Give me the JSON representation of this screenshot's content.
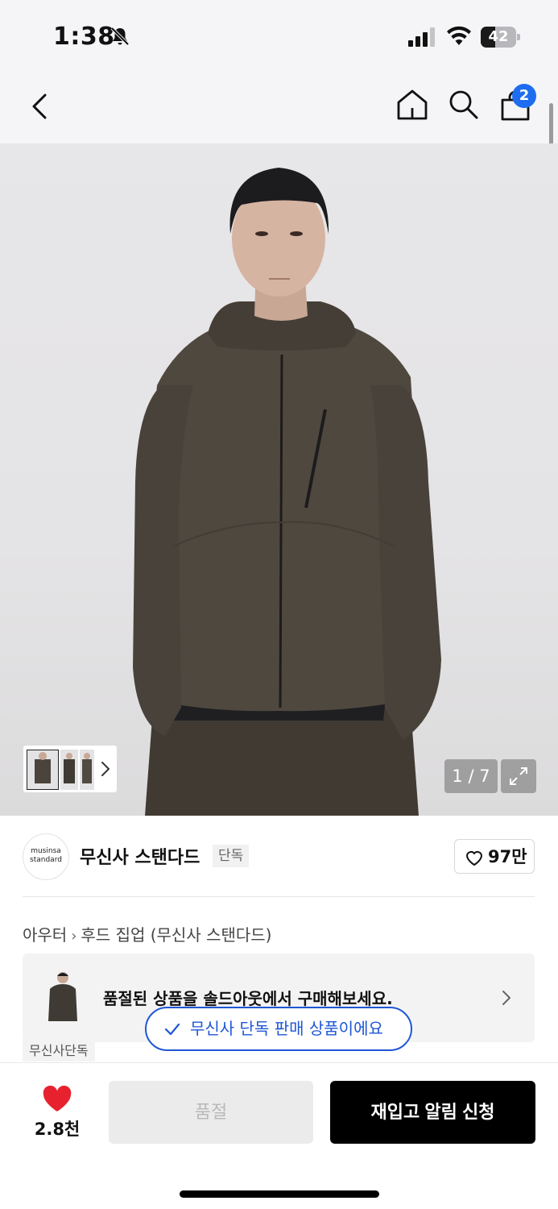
{
  "status_bar": {
    "time": "1:38",
    "battery_level": "42",
    "battery_fraction": 0.42,
    "icons": [
      "bell-mute-icon",
      "cellular-signal-icon",
      "wifi-icon",
      "battery-icon"
    ]
  },
  "nav": {
    "icons": [
      "back-chevron-icon",
      "home-icon",
      "search-icon",
      "shopping-bag-icon"
    ],
    "cart_count": "2",
    "accent_color": "#1e6df0"
  },
  "gallery": {
    "counter": "1 / 7",
    "icons": [
      "chevron-right-icon",
      "expand-icon"
    ]
  },
  "brand": {
    "logo_line1": "musinsa",
    "logo_line2": "standard",
    "name": "무신사 스탠다드",
    "tag": "단독",
    "likes": "97만"
  },
  "breadcrumb": {
    "category": "아우터",
    "subcategory": "후드 집업 (무신사 스탠다드)"
  },
  "soldout_banner": {
    "text": "품절된 상품을 솔드아웃에서 구매해보세요."
  },
  "toast": {
    "text": "무신사 단독 판매 상품이에요",
    "color": "#1e56d6"
  },
  "store_label": "무신사단독",
  "bottom_bar": {
    "wish_count": "2.8천",
    "heart_color": "#e8212e",
    "soldout_label": "품절",
    "restock_label": "재입고 알림 신청"
  }
}
